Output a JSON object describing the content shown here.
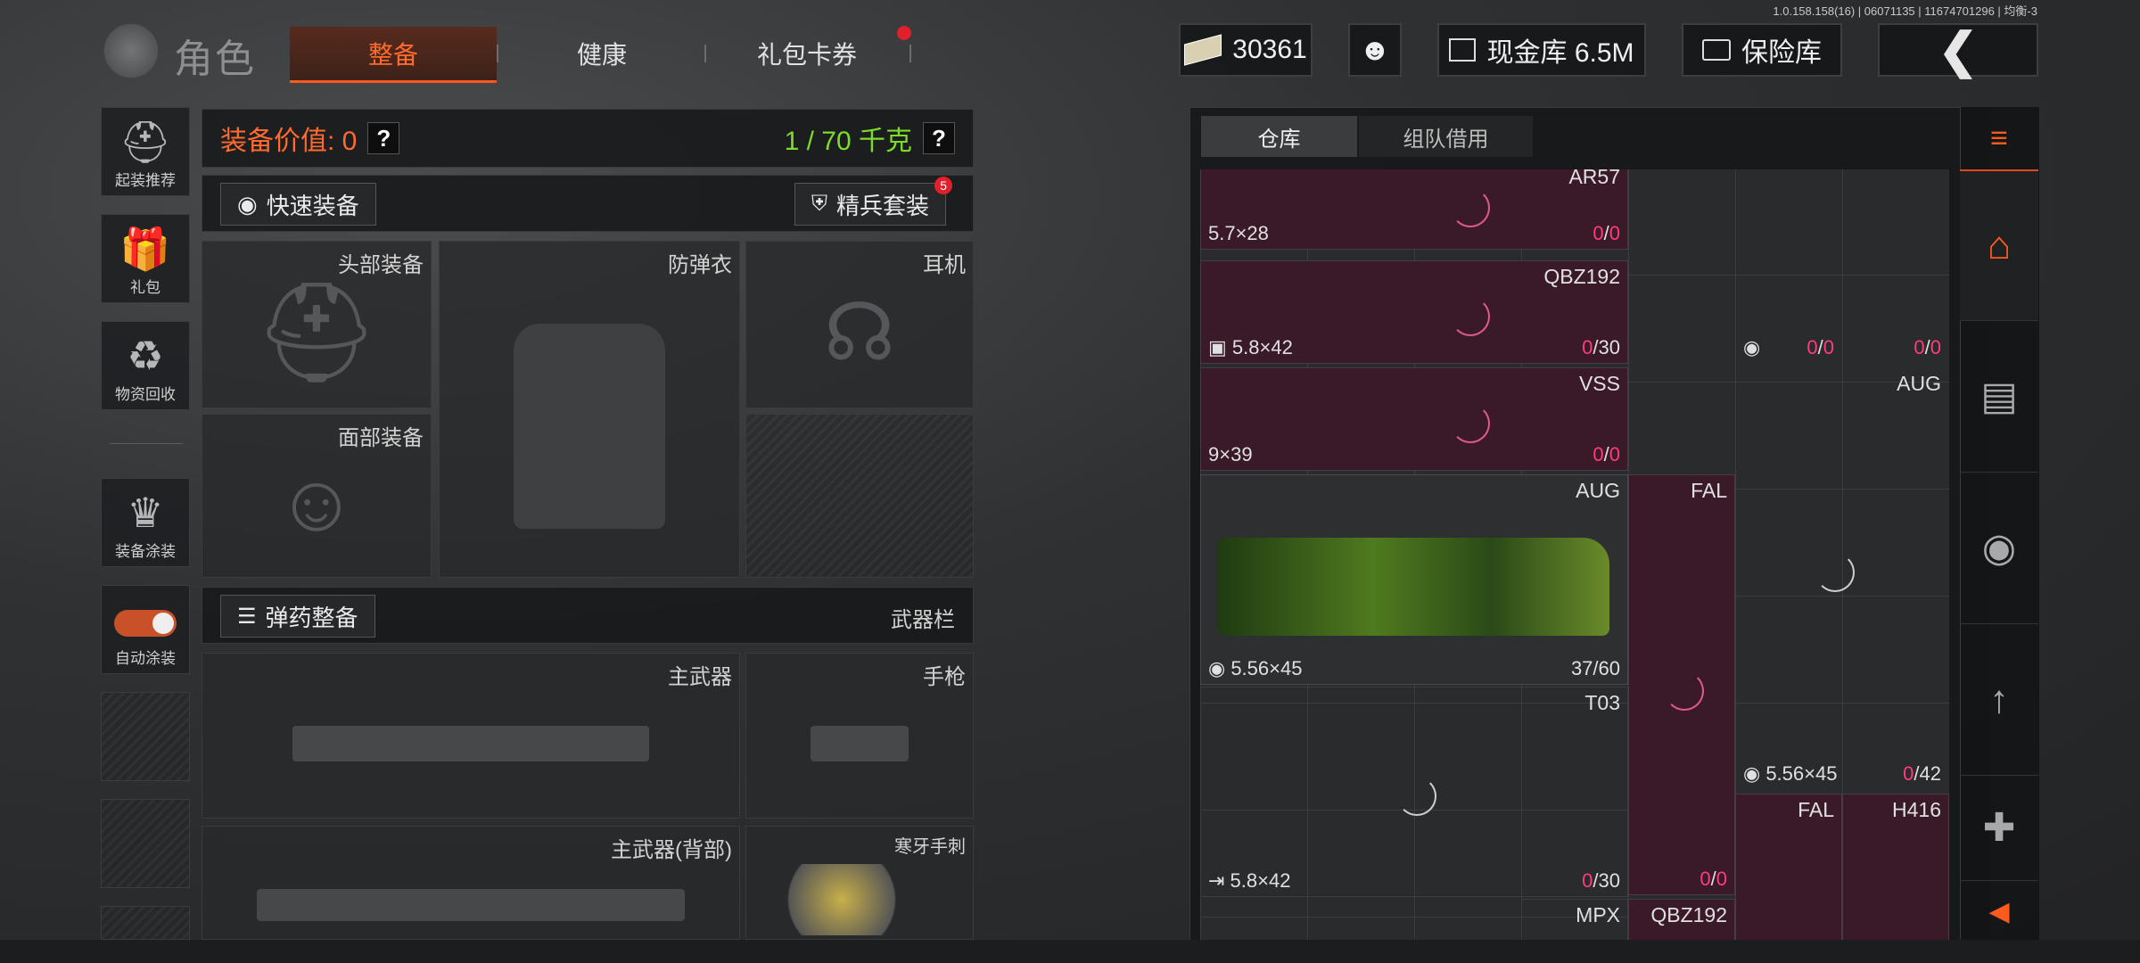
{
  "version": "1.0.158.158(16) | 06071135 | 11674701296 | 均衡-3",
  "header": {
    "title": "角色",
    "tabs": [
      "整备",
      "健康",
      "礼包卡券"
    ],
    "money": "30361",
    "cash_vault": "现金库 6.5M",
    "safe_vault": "保险库"
  },
  "sidebar": {
    "items": [
      {
        "label": "起装推荐",
        "icon": "helmet-icon"
      },
      {
        "label": "礼包",
        "icon": "gift-icon"
      },
      {
        "label": "物资回收",
        "icon": "recycle-icon"
      },
      {
        "label": "装备涂装",
        "icon": "skin-icon"
      },
      {
        "label": "自动涂装",
        "icon": "toggle"
      }
    ]
  },
  "equipment": {
    "value_label": "装备价值: 0",
    "weight_label": "1 / 70 千克",
    "quick_equip": "快速装备",
    "elite_set": "精兵套装",
    "elite_badge": "5",
    "ammo_equip": "弹药整备",
    "weapon_bar": "武器栏",
    "slots": {
      "head": "头部装备",
      "armor": "防弹衣",
      "headset": "耳机",
      "face": "面部装备",
      "primary": "主武器",
      "pistol": "手枪",
      "primary_back": "主武器(背部)",
      "melee": "寒牙手刺"
    }
  },
  "warehouse": {
    "tabs": [
      "仓库",
      "组队借用"
    ],
    "items": [
      {
        "name": "AR57",
        "ammo": "5.7×28",
        "count_a": "0",
        "count_b": "0"
      },
      {
        "name": "QBZ192",
        "ammo": "5.8×42",
        "count_a": "0",
        "count_b": "30"
      },
      {
        "name": "",
        "ammo": "",
        "count_a": "0",
        "count_b": "0"
      },
      {
        "name": "",
        "ammo": "",
        "count_a": "0",
        "count_b": "0"
      },
      {
        "name": "VSS",
        "ammo": "9×39",
        "count_a": "0",
        "count_b": "0"
      },
      {
        "name": "AUG",
        "ammo": "",
        "count_a": "",
        "count_b": ""
      },
      {
        "name": "AUG",
        "ammo": "5.56×45",
        "count": "37/60"
      },
      {
        "name": "FAL",
        "ammo": "",
        "count_a": "0",
        "count_b": "0"
      },
      {
        "name": "T03",
        "ammo": "5.8×42",
        "count_a": "0",
        "count_b": "30"
      },
      {
        "name": "",
        "ammo": "5.56×45",
        "count_a": "0",
        "count_b": "42"
      },
      {
        "name": "FAL",
        "ammo": "",
        "count_a": "",
        "count_b": ""
      },
      {
        "name": "H416",
        "ammo": "",
        "count_a": "",
        "count_b": ""
      },
      {
        "name": "MPX",
        "ammo": "",
        "count_a": "",
        "count_b": ""
      },
      {
        "name": "QBZ192",
        "ammo": "",
        "count_a": "",
        "count_b": ""
      }
    ]
  }
}
